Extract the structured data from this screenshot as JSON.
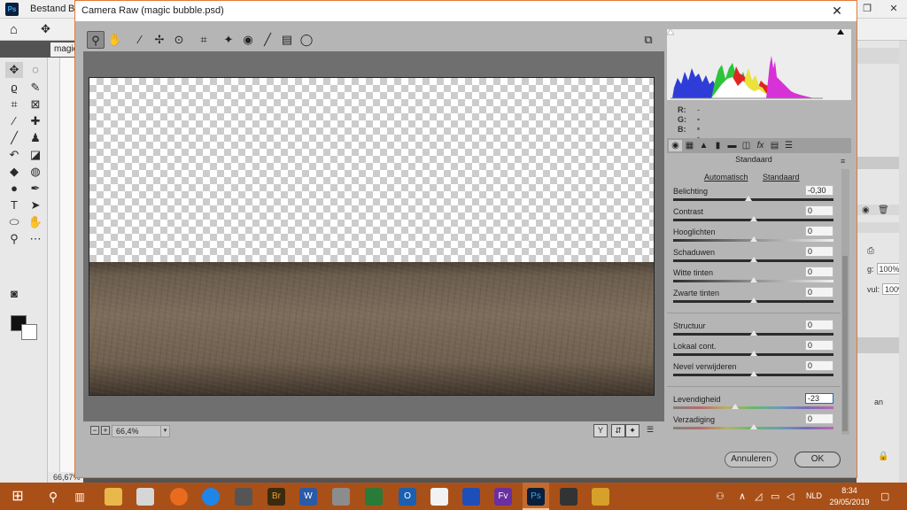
{
  "photoshop": {
    "logo": "Ps",
    "menu": [
      "Bestand",
      "Be"
    ],
    "window_controls": [
      "—",
      "❐",
      "✕"
    ],
    "doc_tab": "magic",
    "zoom_status": "66,67%",
    "opacity_label": "g:",
    "opacity_value": "100%",
    "fill_label": "vul:",
    "fill_value": "100%",
    "layer_text": "an"
  },
  "camera_raw": {
    "title": "Camera Raw (magic bubble.psd)",
    "close": "✕",
    "zoom_value": "66,4%",
    "rgb": {
      "r_label": "R:",
      "r_value": "---",
      "g_label": "G:",
      "g_value": "---",
      "b_label": "B:",
      "b_value": "---"
    },
    "panel_title": "Standaard",
    "auto_link": "Automatisch",
    "default_link": "Standaard",
    "sliders": [
      {
        "label": "Belichting",
        "value": "-0,30",
        "level": -0.06
      },
      {
        "label": "Contrast",
        "value": "0",
        "level": 0
      },
      {
        "label": "Hooglichten",
        "value": "0",
        "level": 0
      },
      {
        "label": "Schaduwen",
        "value": "0",
        "level": 0
      },
      {
        "label": "Witte tinten",
        "value": "0",
        "level": 0
      },
      {
        "label": "Zwarte tinten",
        "value": "0",
        "level": 0
      },
      {
        "label": "Structuur",
        "value": "0",
        "level": 0
      },
      {
        "label": "Lokaal cont.",
        "value": "0",
        "level": 0
      },
      {
        "label": "Nevel verwijderen",
        "value": "0",
        "level": 0
      },
      {
        "label": "Levendigheid",
        "value": "-23",
        "level": -0.23
      },
      {
        "label": "Verzadiging",
        "value": "0",
        "level": 0
      }
    ],
    "cancel_label": "Annuleren",
    "ok_label": "OK"
  },
  "taskbar": {
    "language": "NLD",
    "time": "8:34",
    "date": "29/05/2019"
  },
  "colors": {
    "accent_border": "#e07b39",
    "taskbar": "#a95018"
  }
}
